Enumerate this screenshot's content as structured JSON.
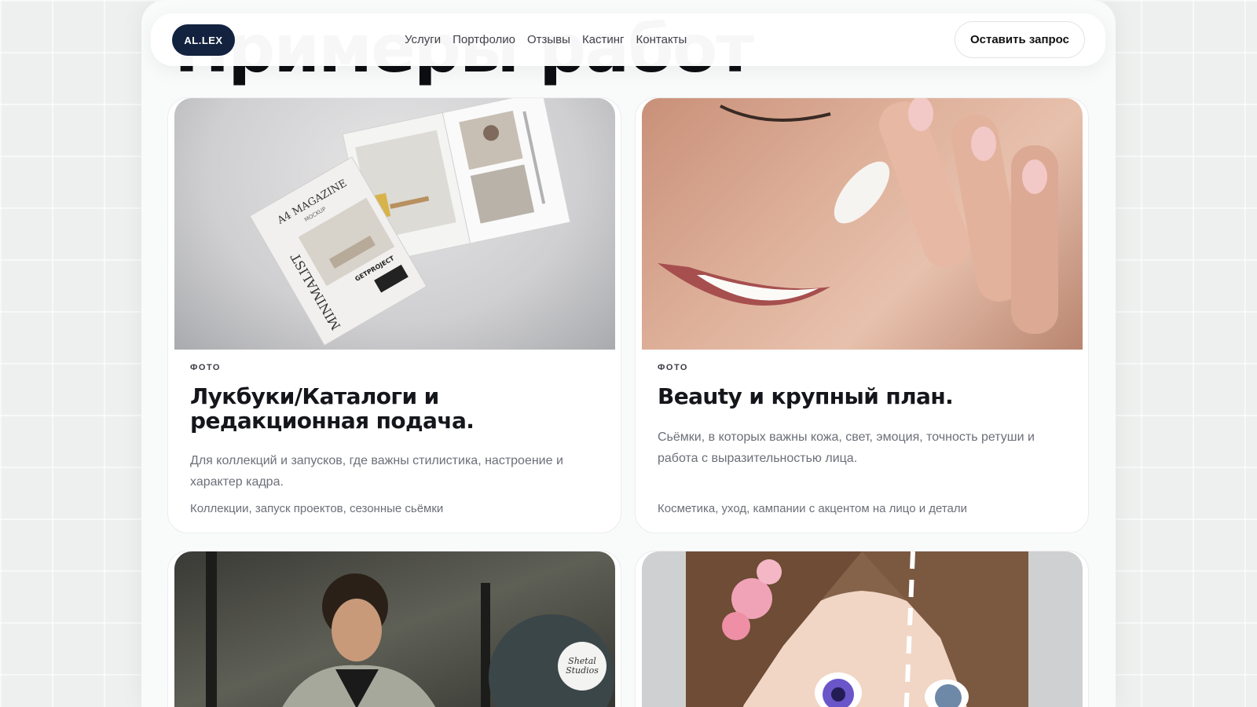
{
  "section": {
    "title": "Примеры работ"
  },
  "nav": {
    "logo": "AL.LEX",
    "links": [
      "Услуги",
      "Портфолио",
      "Отзывы",
      "Кастинг",
      "Контакты"
    ],
    "cta": "Оставить запрос"
  },
  "cards": [
    {
      "tag": "ФОТО",
      "title": "Лукбуки/Каталоги и редакционная подача.",
      "description": "Для коллекций и запусков, где важны стилистика, настроение и характер кадра.",
      "meta": "Коллекции, запуск проектов, сезонные сьёмки",
      "image": {
        "magazine_cover": "A4 MAGAZINE",
        "magazine_sub": "MOCKUP",
        "spine_text": "MINIMALIST",
        "label": "GETPROJECT"
      }
    },
    {
      "tag": "ФОТО",
      "title": "Beauty и крупный план.",
      "description": "Сьёмки, в которых важны кожа, свет, эмоция, точность ретуши и работа с выразительностью лица.",
      "meta": "Косметика, уход, кампании с акцентом на лицо и детали"
    },
    {
      "image": {
        "watermark": "Shetal Studios"
      }
    },
    {}
  ],
  "colors": {
    "logo_bg": "#13223f",
    "panel_bg": "#f9fafa",
    "card_bg": "#ffffff",
    "muted_text": "#6c6f78"
  }
}
